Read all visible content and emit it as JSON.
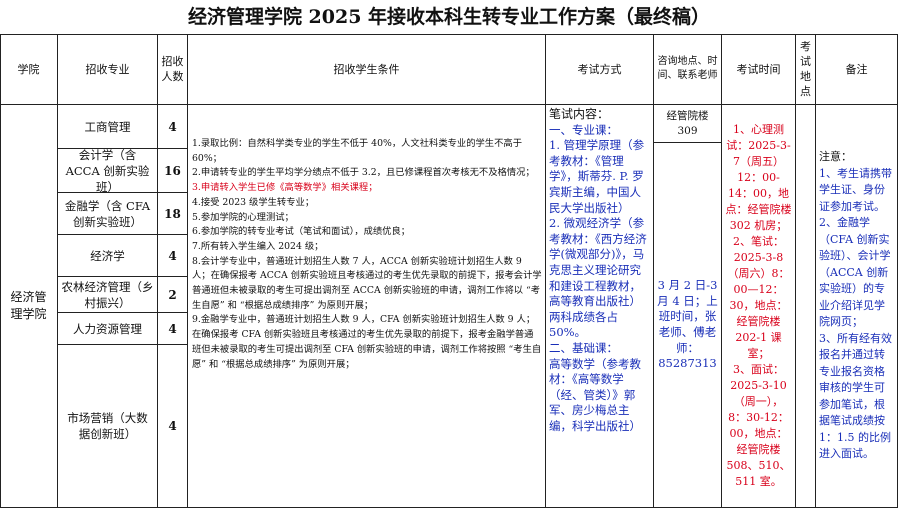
{
  "title": "经济管理学院 2025 年接收本科生转专业工作方案（最终稿）",
  "headers": {
    "college": "学院",
    "major": "招收专业",
    "count": "招收人数",
    "conditions": "招收学生条件",
    "exam_method": "考试方式",
    "contact": "咨询地点、时间、联系老师",
    "exam_time": "考试时间",
    "exam_place": "考试地点",
    "remarks": "备注"
  },
  "college": "经济管理学院",
  "majors": [
    {
      "name": "工商管理",
      "count": "4"
    },
    {
      "name": "会计学（含 ACCA 创新实验班）",
      "count": "16"
    },
    {
      "name": "金融学（含 CFA 创新实验班）",
      "count": "18"
    },
    {
      "name": "经济学",
      "count": "4"
    },
    {
      "name": "农林经济管理（乡村振兴）",
      "count": "2"
    },
    {
      "name": "人力资源管理",
      "count": "4"
    },
    {
      "name": "市场营销（大数据创新班）",
      "count": "4"
    }
  ],
  "conditions": [
    "1.录取比例：自然科学类专业的学生不低于 40%，人文社科类专业的学生不高于 60%；",
    "2.申请转专业的学生平均学分绩点不低于 3.2，且已修课程首次考核无不及格情况；",
    "3.申请转入学生已修《高等数学》相关课程；",
    "4.接受 2023 级学生转专业；",
    "5.参加学院的心理测试；",
    "6.参加学院的转专业考试（笔试和面试），成绩优良；",
    "7.所有转入学生编入 2024 级；",
    "8.会计学专业中，普通班计划招生人数 7 人，ACCA 创新实验班计划招生人数 9 人；在确保报考 ACCA 创新实验班且考核通过的考生优先录取的前提下，报考会计学普通班但未被录取的考生可提出调剂至 ACCA 创新实验班的申请，调剂工作将以 “考生自愿” 和 “根据总成绩排序” 为原则开展；",
    "9.金融学专业中，普通班计划招生人数 9 人，CFA 创新实验班计划招生人数 9 人；在确保报考 CFA 创新实验班且考核通过的考生优先录取的前提下，报考金融学普通班但未被录取的考生可提出调剂至 CFA 创新实验班的申请，调剂工作将按照 “考生自愿” 和 “根据总成绩排序” 为原则开展；"
  ],
  "exam": {
    "heading": "笔试内容：",
    "sub1": "一、专业课：",
    "sub1_text": "1. 管理学原理（参考教材：《管理学》，斯蒂芬. P. 罗宾斯主编，中国人民大学出版社）",
    "sub1_text2": "2. 微观经济学（参考教材：《西方经济学(微观部分)》，马克思主义理论研究和建设工程教材，高等教育出版社）",
    "weight": "两科成绩各占 50%。",
    "sub2": "二、基础课：",
    "sub2_text": "高等数学（参考教材：《高等数学（经、管类）》郭军、房少梅总主编，科学出版社）"
  },
  "contact": {
    "venue": "经管院楼 309",
    "details": "3 月 2 日-3 月 4 日；上班时间，张老师、傅老师：85287313"
  },
  "exam_time": [
    "1、心理测试：2025-3-7（周五）12：00-14：00，地点：经管院楼 302 机房；",
    "2、笔试：2025-3-8（周六）8：00—12：30，地点：经管院楼 202-1 课室；",
    "3、面试：2025-3-10（周一），8：30-12：00，地点：经管院楼 508、510、511 室。"
  ],
  "remarks": {
    "intro": "注意：",
    "items": [
      "1、考生请携带学生证、身份证参加考试。",
      "2、金融学（CFA 创新实验班）、会计学（ACCA 创新实验班）的专业介绍详见学院网页；",
      "3、所有经有效报名并通过转专业报名资格审核的学生可参加笔试，根据笔试成绩按 1：1.5 的比例进入面试。"
    ]
  }
}
